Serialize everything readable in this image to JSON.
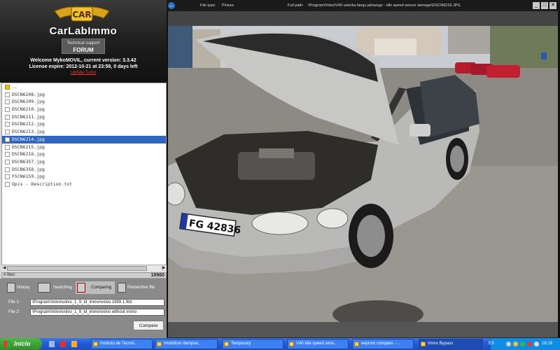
{
  "app": {
    "logo_text": "CarLabImmo",
    "logo_badge": "CAR",
    "support_line": "Technical support",
    "forum_label": "FORUM",
    "welcome_line1": "Welcome MykoMOVIL, current version: 3.3.42",
    "welcome_line2": "License expire: 2012-10-21 at 23:59, 0 days left",
    "update_link": "Update Turbo"
  },
  "files": [
    {
      "name": "..",
      "type": "folder"
    },
    {
      "name": "DSCN6208.jpg",
      "type": "file"
    },
    {
      "name": "DSCN6209.jpg",
      "type": "file"
    },
    {
      "name": "DSCN6210.jpg",
      "type": "file"
    },
    {
      "name": "DSCN6211.jpg",
      "type": "file"
    },
    {
      "name": "DSCN6212.jpg",
      "type": "file"
    },
    {
      "name": "DSCN6213.jpg",
      "type": "file"
    },
    {
      "name": "DSCN6214.jpg",
      "type": "file",
      "selected": true
    },
    {
      "name": "DSCN6215.jpg",
      "type": "file"
    },
    {
      "name": "DSCN6216.jpg",
      "type": "file"
    },
    {
      "name": "DSCN6357.jpg",
      "type": "file"
    },
    {
      "name": "DSCN6358.jpg",
      "type": "file"
    },
    {
      "name": "FSCN6159.jpg",
      "type": "file"
    },
    {
      "name": "Opis - Description.txt",
      "type": "file"
    }
  ],
  "files_bar": {
    "label": "# files:",
    "count": "18960"
  },
  "tools": {
    "history": "History",
    "searching": "Searching",
    "comparing": "Comparing",
    "remember": "Remember file"
  },
  "compare": {
    "file1_label": "File 1:",
    "file1_value": "\\Program\\Volvo\\volvo_1_9_td_immo\\volvo 1999 1.9td",
    "file2_label": "File 2:",
    "file2_value": "\\Program\\Volvo\\volvo_1_9_td_immo\\volvo without immo",
    "button": "Compare"
  },
  "viewer": {
    "file_type_label": "File type:",
    "file_type_value": "Picture",
    "full_path_label": "Full path:",
    "full_path_value": "\\Program\\Volvo\\V40 usterka biegu jalowego - idle speed sensor damage\\DSCN6216.JPG",
    "plate": "FG 42836"
  },
  "taskbar": {
    "start": "Inicio",
    "tasks": [
      "Instituto de Tecnol...",
      "Imobilizer dampov...",
      "Temporary",
      "V40 idle speed sens...",
      "eeprom compare - ...",
      "Immo Bypass"
    ],
    "lang": "ES",
    "time": "16:18"
  }
}
